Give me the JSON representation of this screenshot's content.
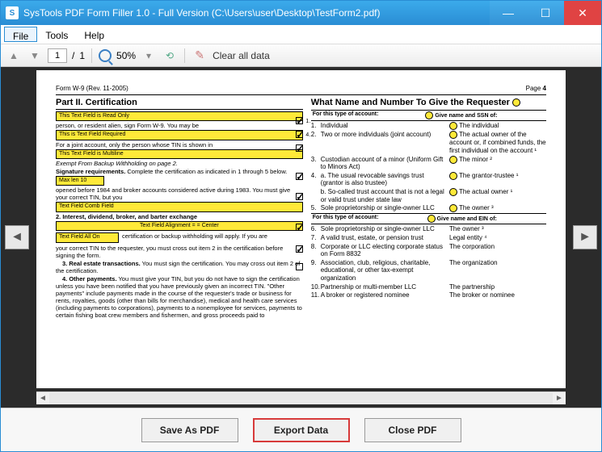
{
  "window": {
    "title": "SysTools PDF Form Filler 1.0 - Full Version (C:\\Users\\user\\Desktop\\TestForm2.pdf)"
  },
  "menu": {
    "file": "File",
    "tools": "Tools",
    "help": "Help"
  },
  "toolbar": {
    "page_current": "1",
    "page_sep": "/",
    "page_total": "1",
    "zoom": "50%",
    "clear": "Clear all data"
  },
  "doc": {
    "form_rev": "Form W-9 (Rev. 11-2005)",
    "page_label": "Page",
    "page_num": "4",
    "part_title": "Part II. Certification",
    "tf_readonly": "This Text Field is Read Only",
    "line_person": "person, or resident alien, sign Form W-9. You may be",
    "tf_required": "This is Text Field Required",
    "line_joint": "For a joint account, only the person whose TIN is shown in",
    "tf_multiline": "This Text Field is Multiline",
    "line_exempt": "Exempt From Backup Withholding on page 2.",
    "sig_req": "Signature requirements.",
    "sig_req_rest": " Complete the certification as indicated in 1 through 5 below.",
    "tf_maxlen": "Max len 10",
    "line_opened": "opened before 1984 and broker accounts considered active during 1983. You must give your correct TIN, but you",
    "tf_combo": "Text Field Comb Field",
    "item2": "2. Interest, dividend, broker, and barter exchange",
    "tf_align": "Text Field Alignment = = Center",
    "tf_allon_label": "Text Field All On",
    "line_cert": "certification or backup withholding will apply. If you are",
    "line_crossout": "your correct TIN to the requester, you must cross out item 2 in the certification before signing the form.",
    "item3": "3. Real estate transactions.",
    "item3_rest": " You must sign the certification. You may cross out item 2 of the certification.",
    "item4": "4. Other payments.",
    "item4_rest": " You must give your TIN, but you do not have to sign the certification unless you have been notified that you have previously given an incorrect TIN. \"Other payments\" include payments made in the course of the requester's trade or business for rents, royalties, goods (other than bills for merchandise), medical and health care services (including payments to corporations), payments to a nonemployee for services, payments to certain fishing boat crew members and fishermen, and gross proceeds paid to",
    "rcol_title": "What Name and Number To Give the Requester",
    "hdr_type": "For this type of account:",
    "hdr_ssn": "Give name and SSN of:",
    "hdr_ein": "Give name and EIN of:",
    "rows_ssn": [
      {
        "n": "1.",
        "l": "Individual",
        "r": "The individual"
      },
      {
        "n": "2.",
        "l": "Two or more individuals (joint account)",
        "r": "The actual owner of the account or, if combined funds, the first individual on the account ¹"
      },
      {
        "n": "3.",
        "l": "Custodian account of a minor (Uniform Gift to Minors Act)",
        "r": "The minor ²"
      },
      {
        "n": "4.",
        "l": "a. The usual revocable savings trust (grantor is also trustee)",
        "r": "The grantor-trustee ¹"
      },
      {
        "n": "",
        "l": "b. So-called trust account that is not a legal or valid trust under state law",
        "r": "The actual owner ¹"
      },
      {
        "n": "5.",
        "l": "Sole proprietorship or single-owner LLC",
        "r": "The owner ³"
      }
    ],
    "rows_ein": [
      {
        "n": "6.",
        "l": "Sole proprietorship or single-owner LLC",
        "r": "The owner ³"
      },
      {
        "n": "7.",
        "l": "A valid trust, estate, or pension trust",
        "r": "Legal entity ⁴"
      },
      {
        "n": "8.",
        "l": "Corporate or LLC electing corporate status on Form 8832",
        "r": "The corporation"
      },
      {
        "n": "9.",
        "l": "Association, club, religious, charitable, educational, or other tax-exempt organization",
        "r": "The organization"
      },
      {
        "n": "10.",
        "l": "Partnership or multi-member LLC",
        "r": "The partnership"
      },
      {
        "n": "11.",
        "l": "A broker or registered nominee",
        "r": "The broker or nominee"
      }
    ],
    "midchecks": [
      "1.",
      "4."
    ]
  },
  "actions": {
    "save": "Save As PDF",
    "export": "Export Data",
    "close": "Close PDF"
  },
  "chart_data": null
}
